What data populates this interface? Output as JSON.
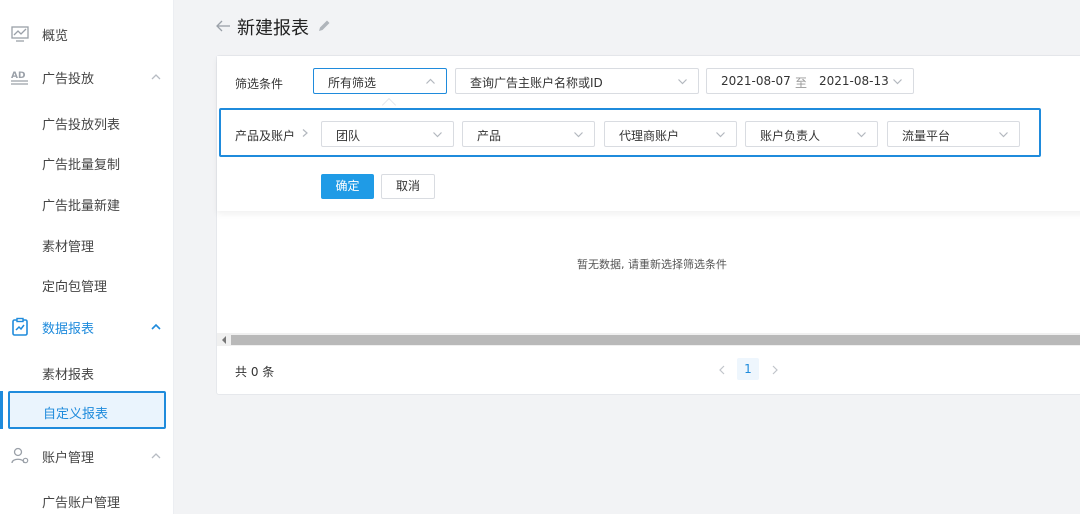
{
  "sidebar": {
    "overview": "概览",
    "ad_delivery": {
      "label": "广告投放",
      "items": [
        "广告投放列表",
        "广告批量复制",
        "广告批量新建",
        "素材管理",
        "定向包管理"
      ]
    },
    "data_reports": {
      "label": "数据报表",
      "items": [
        "素材报表",
        "自定义报表"
      ]
    },
    "account_mgmt": {
      "label": "账户管理",
      "items": [
        "广告账户管理"
      ]
    }
  },
  "header": {
    "title": "新建报表"
  },
  "filter": {
    "label": "筛选条件",
    "scope_select": "所有筛选",
    "account_search_placeholder": "查询广告主账户名称或ID",
    "date_start": "2021-08-07",
    "date_sep": "至",
    "date_end": "2021-08-13"
  },
  "product_account": {
    "label": "产品及账户",
    "selects": [
      "团队",
      "产品",
      "代理商账户",
      "账户负责人",
      "流量平台"
    ]
  },
  "actions": {
    "confirm": "确定",
    "cancel": "取消"
  },
  "table": {
    "empty_text": "暂无数据, 请重新选择筛选条件"
  },
  "pagination": {
    "total": "共 0 条",
    "current_page": "1"
  },
  "colors": {
    "accent": "#1f8bdc",
    "primary_button": "#1f9be6",
    "page_bg": "#f2f3f5"
  }
}
